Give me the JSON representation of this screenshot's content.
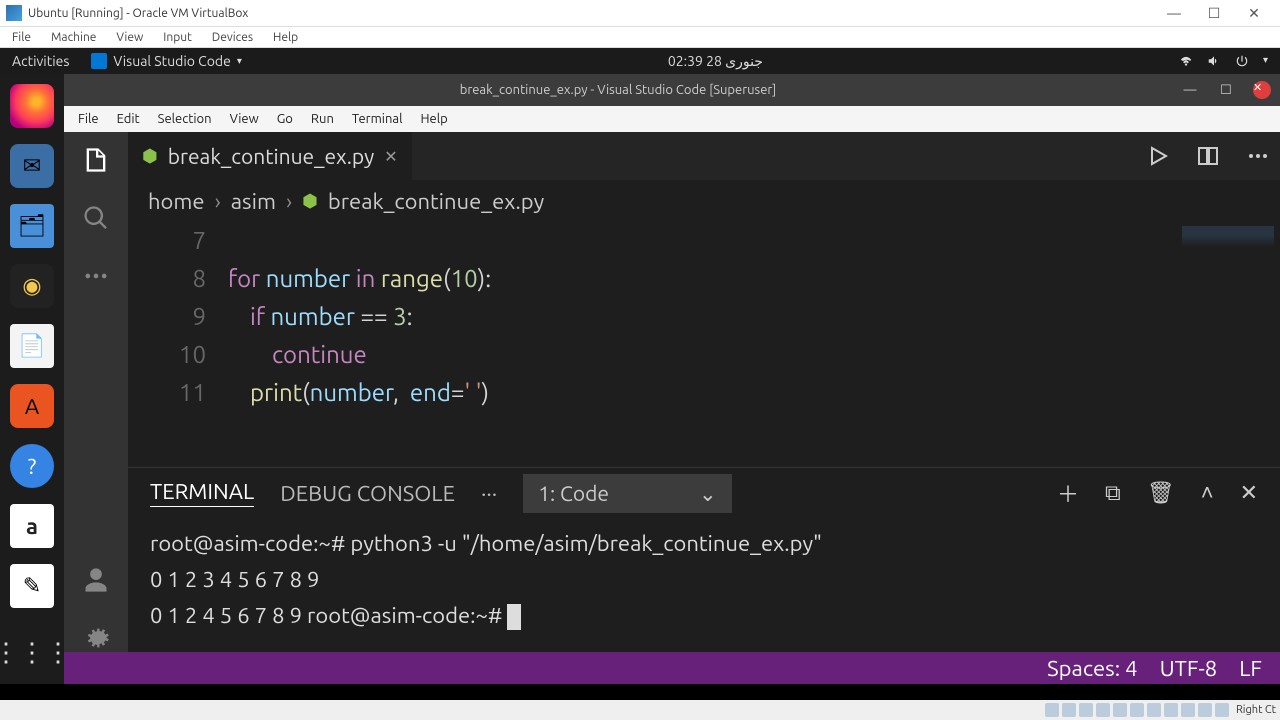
{
  "vbox": {
    "title": "Ubuntu [Running] - Oracle VM VirtualBox",
    "menu": [
      "File",
      "Machine",
      "View",
      "Input",
      "Devices",
      "Help"
    ],
    "hostkey": "Right Ct"
  },
  "gnome": {
    "activities": "Activities",
    "app": "Visual Studio Code",
    "clock": "جنوری 28  02:39"
  },
  "vsc": {
    "title": "break_continue_ex.py - Visual Studio Code [Superuser]",
    "menu": [
      "File",
      "Edit",
      "Selection",
      "View",
      "Go",
      "Run",
      "Terminal",
      "Help"
    ],
    "tab_label": "break_continue_ex.py",
    "breadcrumb": {
      "a": "home",
      "b": "asim",
      "c": "break_continue_ex.py"
    },
    "status": {
      "spaces": "Spaces: 4",
      "enc": "UTF-8",
      "eol": "LF"
    }
  },
  "code": {
    "lines": [
      {
        "n": "7",
        "raw": ""
      },
      {
        "n": "8",
        "raw": "for number in range(10):"
      },
      {
        "n": "9",
        "raw": "    if number == 3:"
      },
      {
        "n": "10",
        "raw": "        continue"
      },
      {
        "n": "11",
        "raw": "    print(number,  end=' ')"
      }
    ]
  },
  "terminal": {
    "tabs": {
      "term": "TERMINAL",
      "debug": "DEBUG CONSOLE"
    },
    "select": "1: Code",
    "l1": "root@asim-code:~# python3 -u \"/home/asim/break_continue_ex.py\"",
    "l2": "0 1 2 3 4 5 6 7 8 9",
    "l3a": "0 1 2 4 5 6 7 8 9 ",
    "l3b": "root@asim-code:~# "
  }
}
